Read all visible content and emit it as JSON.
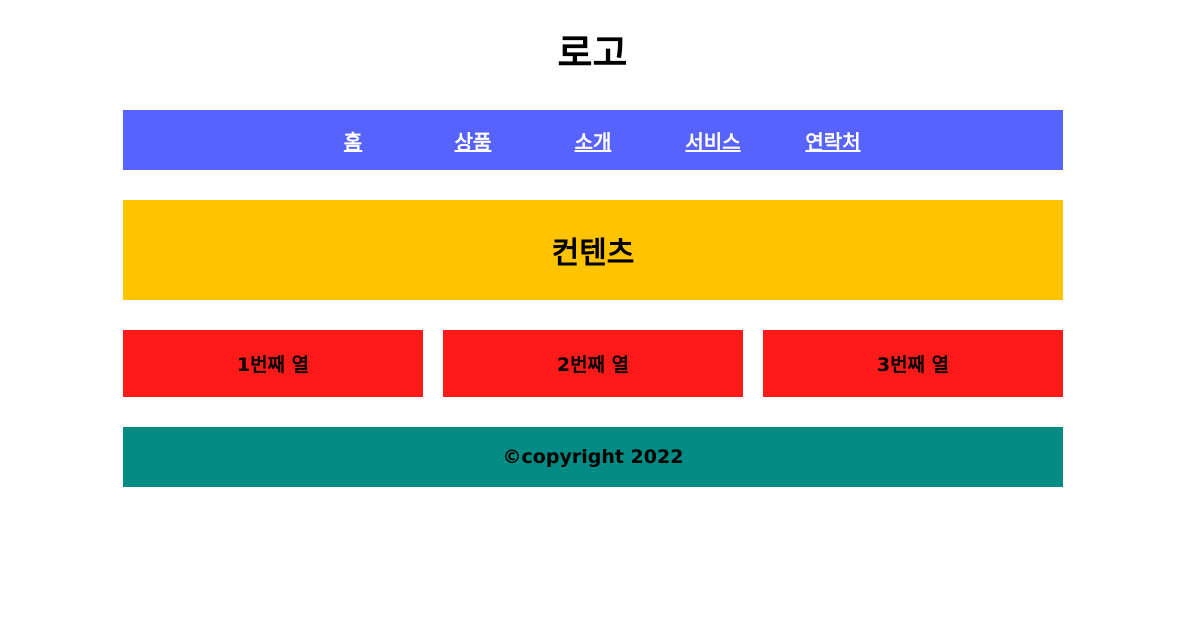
{
  "header": {
    "logo": "로고"
  },
  "nav": {
    "items": [
      {
        "label": "홈"
      },
      {
        "label": "상품"
      },
      {
        "label": "소개"
      },
      {
        "label": "서비스"
      },
      {
        "label": "연락처"
      }
    ]
  },
  "content": {
    "label": "컨텐츠"
  },
  "columns": [
    {
      "label": "1번째 열"
    },
    {
      "label": "2번째 열"
    },
    {
      "label": "3번째 열"
    }
  ],
  "footer": {
    "text": "©copyright 2022"
  },
  "colors": {
    "nav_bg": "#5763ff",
    "content_bg": "#ffc300",
    "column_bg": "#ff1a1a",
    "footer_bg": "#008b85"
  }
}
